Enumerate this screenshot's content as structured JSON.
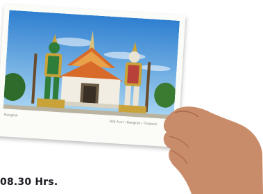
{
  "scene": {
    "subject": "hand holding a postcard photo of a Thai temple with guardian statues",
    "time_text": "08.30 Hrs."
  },
  "postcard": {
    "caption_left": "Bangkok",
    "caption_right": "Wat Arun • Bangkok • Thailand"
  },
  "colors": {
    "sky_top": "#2f7fd0",
    "sky_bottom": "#a9d6f2",
    "roof_orange": "#d86a2a",
    "temple_white": "#f2ede2",
    "guardian_green": "#2e7d3a",
    "guardian_white": "#e9e4d6",
    "gold": "#c9a23a",
    "skin": "#c98c6a",
    "text_dark": "#1b1b22"
  }
}
